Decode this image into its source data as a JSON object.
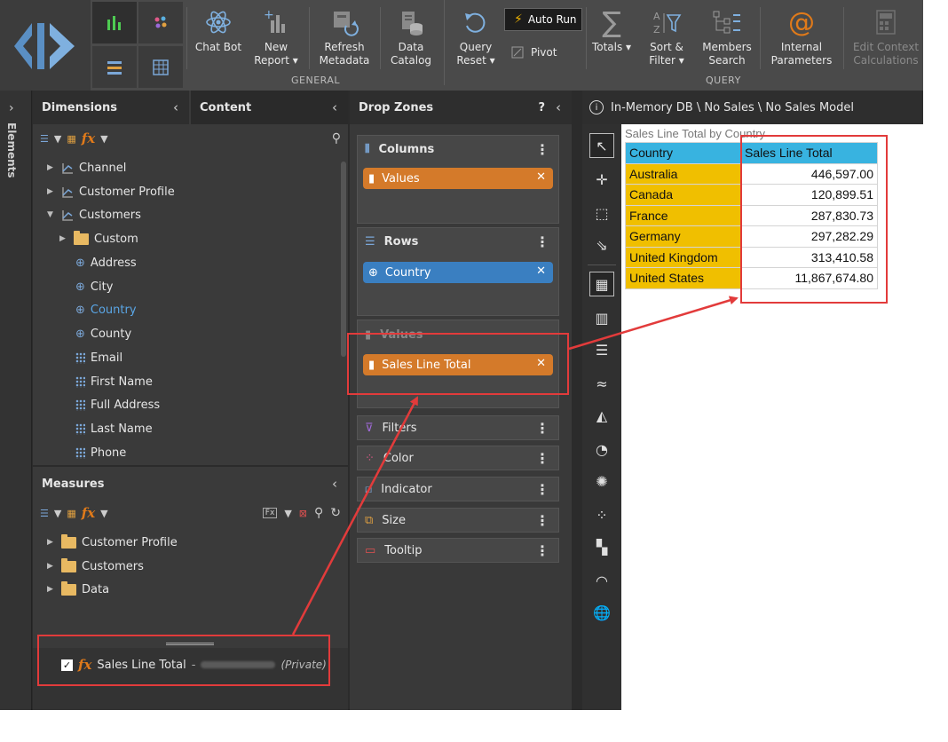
{
  "ribbon": {
    "buttons": [
      {
        "label": "Chat Bot",
        "icon": "atom-icon"
      },
      {
        "label": "New",
        "label2": "Report ▾",
        "icon": "new-report-icon"
      },
      {
        "label": "Refresh",
        "label2": "Metadata",
        "icon": "refresh-metadata-icon"
      },
      {
        "label": "Data",
        "label2": "Catalog",
        "icon": "data-catalog-icon"
      },
      {
        "label": "Query",
        "label2": "Reset ▾",
        "icon": "query-reset-icon"
      },
      {
        "label": "Totals ▾",
        "icon": "sigma-icon"
      },
      {
        "label": "Sort &",
        "label2": "Filter ▾",
        "icon": "sort-filter-icon"
      },
      {
        "label": "Members",
        "label2": "Search",
        "icon": "members-search-icon"
      },
      {
        "label": "Internal",
        "label2": "Parameters",
        "icon": "at-sign-icon"
      },
      {
        "label": "Edit Context",
        "label2": "Calculations",
        "icon": "calculator-icon"
      }
    ],
    "auto_run": "Auto Run",
    "pivot": "Pivot",
    "groups": {
      "general": "GENERAL",
      "query": "QUERY"
    }
  },
  "side_strip": {
    "label": "Elements"
  },
  "dimensions": {
    "title": "Dimensions",
    "items": [
      {
        "label": "Channel"
      },
      {
        "label": "Customer Profile"
      },
      {
        "label": "Customers"
      },
      {
        "label": "Custom"
      },
      {
        "label": "Address"
      },
      {
        "label": "City"
      },
      {
        "label": "Country"
      },
      {
        "label": "County"
      },
      {
        "label": "Email"
      },
      {
        "label": "First Name"
      },
      {
        "label": "Full Address"
      },
      {
        "label": "Last Name"
      },
      {
        "label": "Phone"
      }
    ]
  },
  "content_tab": {
    "title": "Content"
  },
  "measures": {
    "title": "Measures",
    "items": [
      {
        "label": "Customer Profile"
      },
      {
        "label": "Customers"
      },
      {
        "label": "Data"
      }
    ],
    "selected": {
      "label": "Sales Line Total",
      "separator": "-",
      "privacy": "(Private)"
    }
  },
  "drop_zones": {
    "title": "Drop Zones",
    "help": "?",
    "columns": {
      "title": "Columns",
      "pill": "Values"
    },
    "rows": {
      "title": "Rows",
      "pill": "Country"
    },
    "values": {
      "title": "Values",
      "pill": "Sales Line Total"
    },
    "others": [
      "Filters",
      "Color",
      "Indicator",
      "Size",
      "Tooltip"
    ]
  },
  "breadcrumb": "In-Memory DB \\ No Sales \\ No Sales Model",
  "report": {
    "title": "Sales Line Total by Country",
    "header": [
      "Country",
      "Sales Line Total"
    ],
    "rows": [
      {
        "country": "Australia",
        "value": "446,597.00"
      },
      {
        "country": "Canada",
        "value": "120,899.51"
      },
      {
        "country": "France",
        "value": "287,830.73"
      },
      {
        "country": "Germany",
        "value": "297,282.29"
      },
      {
        "country": "United Kingdom",
        "value": "313,410.58"
      },
      {
        "country": "United States",
        "value": "11,867,674.80"
      }
    ]
  },
  "colors": {
    "accent_orange": "#d47a2a",
    "accent_blue": "#3a7fc1",
    "annotation_red": "#e23b3b",
    "header_cyan": "#38b3e0",
    "country_yellow": "#f0bf00"
  }
}
